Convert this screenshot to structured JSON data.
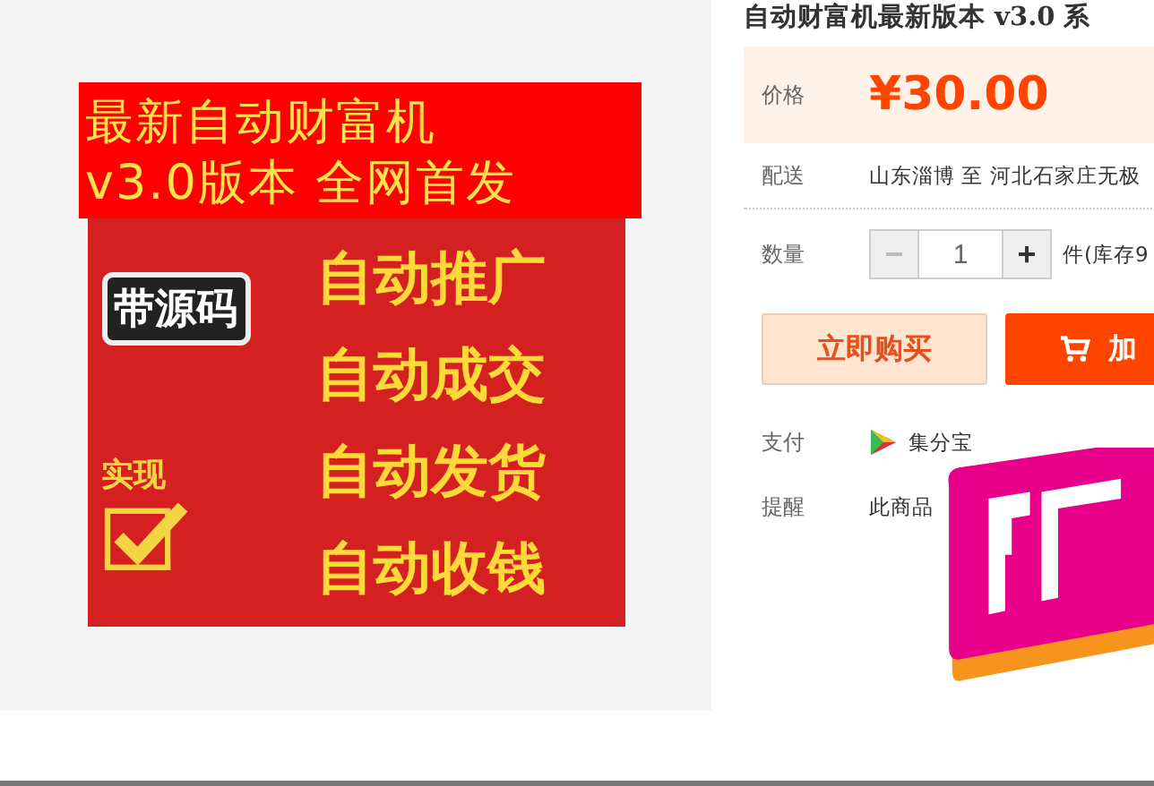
{
  "product_image": {
    "headline": [
      "最新自动财富机",
      "v3.0版本  全网首发"
    ],
    "badge": "带源码",
    "features": [
      "自动推广",
      "自动成交",
      "自动发货",
      "自动收钱"
    ],
    "check_label": "实现"
  },
  "title": "自动财富机最新版本 v3.0 系",
  "price": {
    "label": "价格",
    "value": "¥30.00"
  },
  "delivery": {
    "label": "配送",
    "value": "山东淄博 至  河北石家庄无极"
  },
  "quantity": {
    "label": "数量",
    "minus": "−",
    "value": "1",
    "plus": "+",
    "stock": "件(库存9",
    "minus_disabled": true
  },
  "buttons": [
    {
      "kind": "buy",
      "label": "立即购买"
    },
    {
      "kind": "cart",
      "label": "加"
    }
  ],
  "payment": {
    "label": "支付",
    "method": "集分宝"
  },
  "reminder": {
    "label": "提醒",
    "value": "此商品"
  }
}
